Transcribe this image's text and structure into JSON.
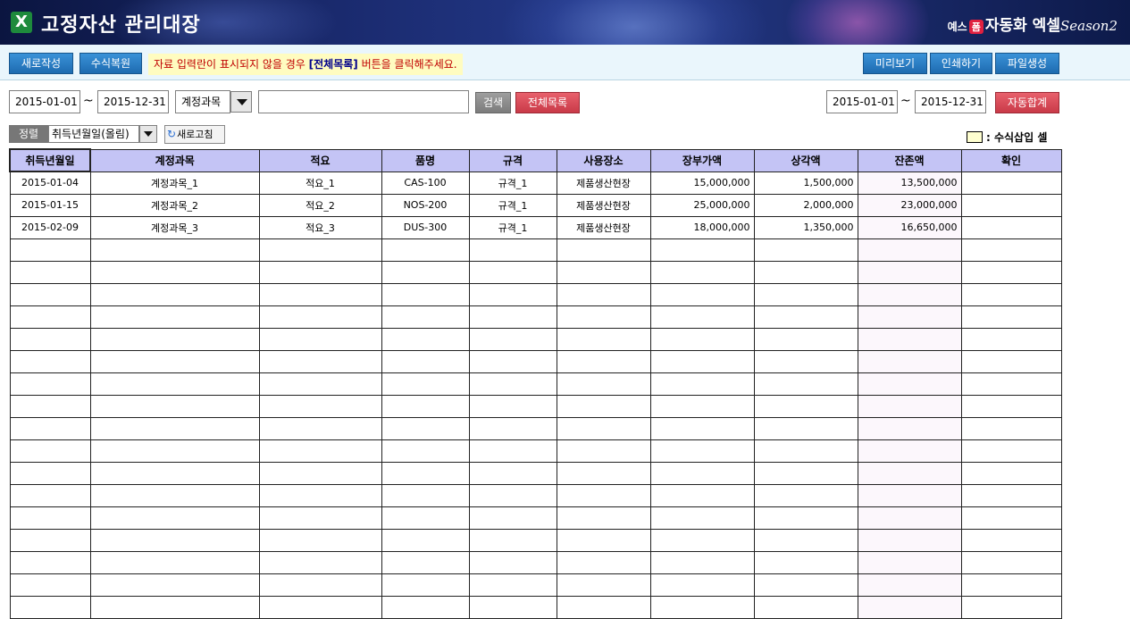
{
  "header": {
    "icon_letter": "X",
    "title": "고정자산 관리대장",
    "brand_prefix": "예스",
    "brand_badge": "폼",
    "brand_name": "자동화 엑셀",
    "brand_season": "Season2"
  },
  "toolbar": {
    "new_label": "새로작성",
    "restore_label": "수식복원",
    "notice_pre": "자료 입력란이 표시되지  않을 경우 ",
    "notice_bold": "[전체목록]",
    "notice_post": " 버튼을 클릭해주세요.",
    "preview_label": "미리보기",
    "print_label": "인쇄하기",
    "file_label": "파일생성"
  },
  "filter": {
    "date_from": "2015-01-01",
    "tilde": "~",
    "date_to": "2015-12-31",
    "category": "계정과목",
    "keyword": "",
    "search_label": "검색",
    "all_label": "전체목록",
    "sum_from": "2015-01-01",
    "sum_to": "2015-12-31",
    "autosum_label": "자동합계"
  },
  "sort": {
    "label": "정렬",
    "value": "취득년월일(올림)",
    "refresh_label": "새로고침"
  },
  "legend": {
    "text": ": 수식삽입 셀"
  },
  "table": {
    "columns": [
      "취득년월일",
      "계정과목",
      "적요",
      "품명",
      "규격",
      "사용장소",
      "장부가액",
      "상각액",
      "잔존액",
      "확인"
    ],
    "rows": [
      [
        "2015-01-04",
        "계정과목_1",
        "적요_1",
        "CAS-100",
        "규격_1",
        "제품생산현장",
        "15,000,000",
        "1,500,000",
        "13,500,000",
        ""
      ],
      [
        "2015-01-15",
        "계정과목_2",
        "적요_2",
        "NOS-200",
        "규격_1",
        "제품생산현장",
        "25,000,000",
        "2,000,000",
        "23,000,000",
        ""
      ],
      [
        "2015-02-09",
        "계정과목_3",
        "적요_3",
        "DUS-300",
        "규격_1",
        "제품생산현장",
        "18,000,000",
        "1,350,000",
        "16,650,000",
        ""
      ]
    ],
    "empty_rows": 17
  },
  "colors": {
    "header_bg": "#c4c4f5",
    "formula_cell": "#ffffd0",
    "toolbar_button": "#1e6bb0",
    "red_button": "#c93a48"
  }
}
